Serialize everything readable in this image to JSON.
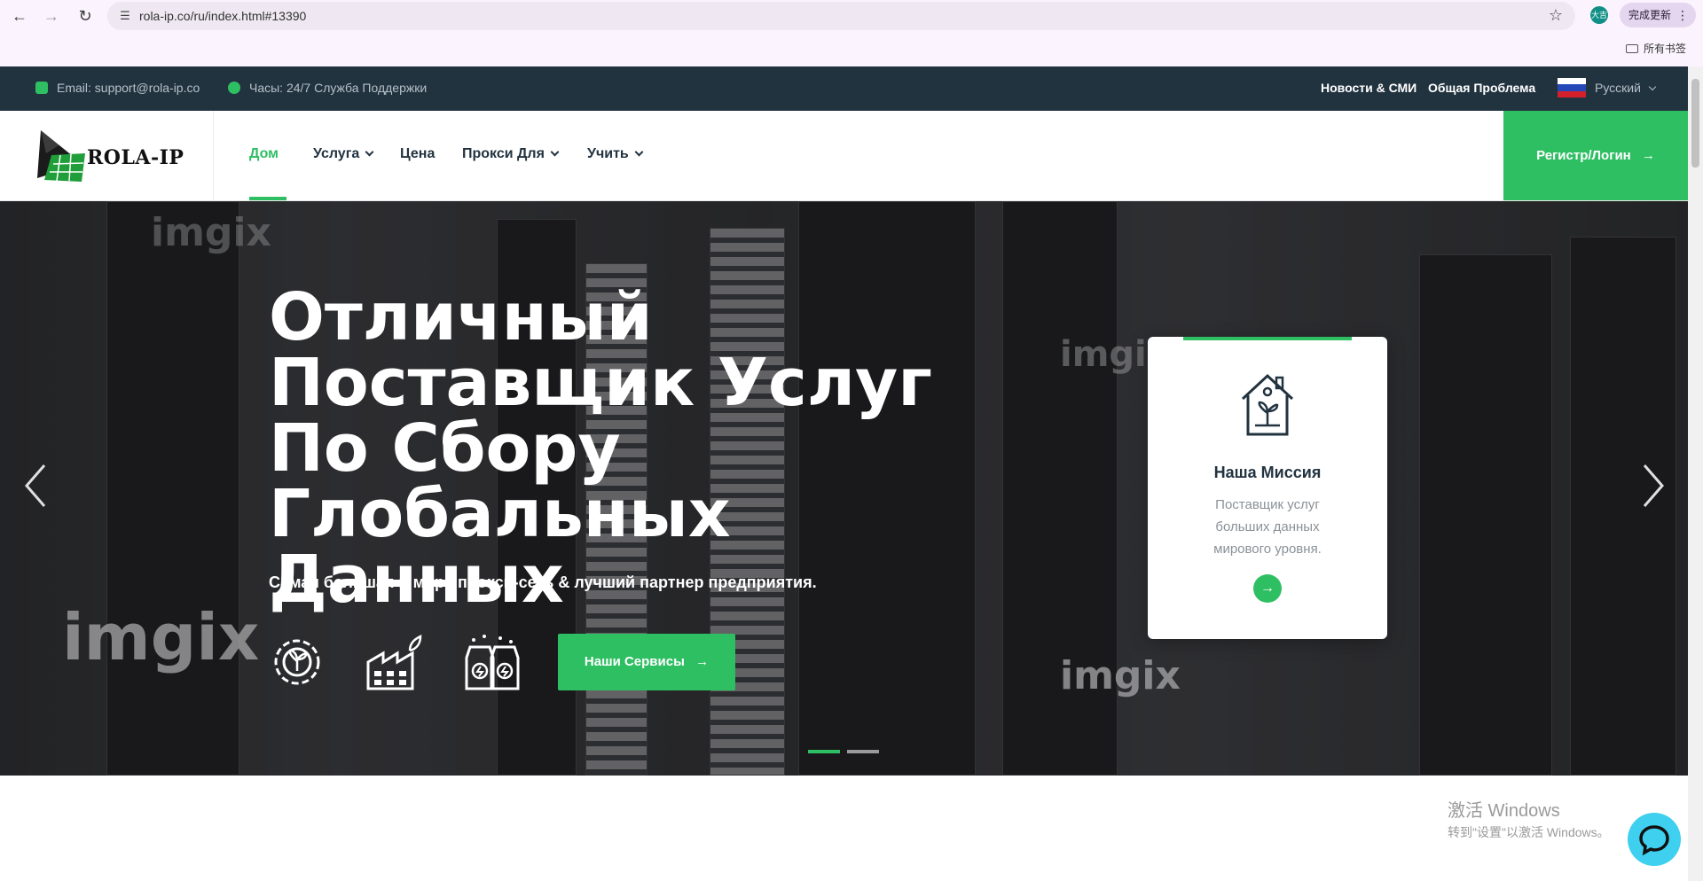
{
  "browser": {
    "url": "rola-ip.co/ru/index.html#13390",
    "profile_initial": "大吉",
    "update_label": "完成更新",
    "bookmarks_label": "所有书签"
  },
  "topbar": {
    "email": "Email: support@rola-ip.co",
    "hours": "Часы: 24/7 Служба Поддержки",
    "news": "Новости & СМИ",
    "faq": "Общая Проблема",
    "language": "Русский"
  },
  "header": {
    "logo_text": "ROLA-IP",
    "menu": [
      {
        "label": "Дом",
        "active": true,
        "dropdown": false
      },
      {
        "label": "Услуга",
        "active": false,
        "dropdown": true
      },
      {
        "label": "Цена",
        "active": false,
        "dropdown": false
      },
      {
        "label": "Прокси Для",
        "active": false,
        "dropdown": true
      },
      {
        "label": "Учить",
        "active": false,
        "dropdown": true
      }
    ],
    "register_label": "Регистр/Логин"
  },
  "hero": {
    "title": "Отличный Поставщик Услуг По Сбору Глобальных Данных",
    "subtitle": "Самая большая в мире прокси-сеть & лучший партнер предприятия.",
    "services_label": "Наши Сервисы",
    "background_brand": "imgix",
    "slides": 2,
    "active_slide": 1
  },
  "card": {
    "title": "Наша Миссия",
    "text": "Поставщик услуг больших данных мирового уровня."
  },
  "watermark": {
    "line1": "激活 Windows",
    "line2": "转到\"设置\"以激活 Windows。"
  },
  "colors": {
    "accent": "#2fbf63",
    "topbar_bg": "#223340",
    "text_dark": "#223340"
  }
}
